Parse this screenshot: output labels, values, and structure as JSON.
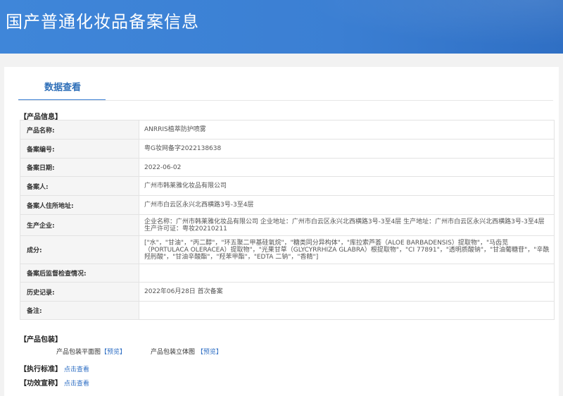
{
  "header": {
    "title": "国产普通化妆品备案信息"
  },
  "tab": {
    "label": "数据查看"
  },
  "product_info": {
    "section_label": "【产品信息】",
    "rows": [
      {
        "label": "产品名称:",
        "value": "ANRRIS植萃防护喷雾"
      },
      {
        "label": "备案编号:",
        "value": "粤G妆网备字2022138638"
      },
      {
        "label": "备案日期:",
        "value": "2022-06-02"
      },
      {
        "label": "备案人:",
        "value": "广州市韩莱雅化妆品有限公司"
      },
      {
        "label": "备案人住所地址:",
        "value": "广州市白云区永兴北西横路3号-3至4层"
      },
      {
        "label": "生产企业:",
        "value": "企业名称：广州市韩莱雅化妆品有限公司 企业地址：广州市白云区永兴北西横路3号-3至4层 生产地址：广州市白云区永兴北西横路3号-3至4层 生产许可证：粤妆20210211"
      },
      {
        "label": "成分:",
        "value": "[\"水\"，\"甘油\"，\"丙二醇\"，\"环五聚二甲基硅氧烷\"，\"糖类同分异构体\"，\"库拉索芦荟（ALOE BARBADENSIS）提取物\"，\"马齿苋（PORTULACA OLERACEA）提取物\"，\"光果甘草（GLYCYRRHIZA GLABRA）根提取物\"，\"CI 77891\"，\"透明质酸钠\"，\"甘油葡糖苷\"，\"辛酰羟肟酸\"，\"甘油辛酸酯\"，\"羟苯甲酯\"，\"EDTA 二钠\"，\"香精\"]"
      },
      {
        "label": "备案后监督检查情况:",
        "value": ""
      },
      {
        "label": "历史记录:",
        "value": "2022年06月28日 首次备案"
      },
      {
        "label": "备注:",
        "value": ""
      }
    ]
  },
  "packaging": {
    "section_label": "【产品包装】",
    "flat_label": "产品包装平面图",
    "flat_link": "【预览】",
    "solid_label": "产品包装立体图",
    "solid_link": "【预览】"
  },
  "standard": {
    "section_label": "【执行标准】",
    "link": "点击查看"
  },
  "efficacy": {
    "section_label": "【功效宣称】",
    "link": "点击查看"
  }
}
